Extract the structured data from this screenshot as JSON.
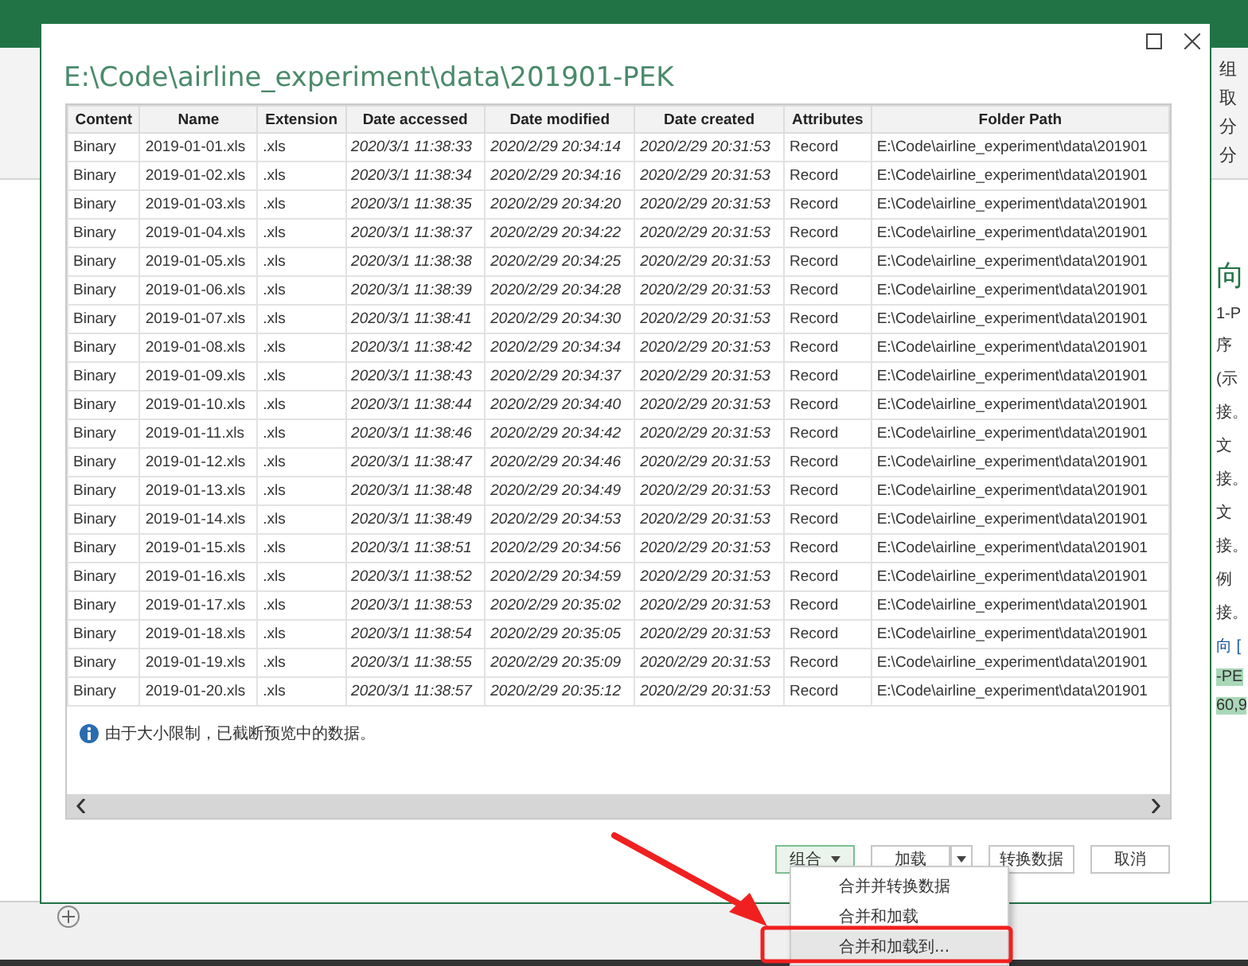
{
  "background_app": {
    "ribbon_right": [
      "组",
      "取",
      "分",
      "分"
    ],
    "pane_right": [
      {
        "text": "向",
        "kind": "heading"
      },
      {
        "text": "1-P",
        "kind": "line"
      },
      {
        "text": "序",
        "kind": "line"
      },
      {
        "text": "(示",
        "kind": "line"
      },
      {
        "text": "接。",
        "kind": "line"
      },
      {
        "text": "文",
        "kind": "line"
      },
      {
        "text": "接。",
        "kind": "line"
      },
      {
        "text": "文",
        "kind": "line"
      },
      {
        "text": "接。",
        "kind": "line"
      },
      {
        "text": "例",
        "kind": "line"
      },
      {
        "text": "接。",
        "kind": "line"
      },
      {
        "text": "向 [",
        "kind": "link"
      },
      {
        "text": "-PE",
        "kind": "selected"
      },
      {
        "text": "60,9",
        "kind": "selected"
      }
    ]
  },
  "dialog": {
    "title": "E:\\Code\\airline_experiment\\data\\201901-PEK",
    "table": {
      "columns": [
        "Content",
        "Name",
        "Extension",
        "Date accessed",
        "Date modified",
        "Date created",
        "Attributes",
        "Folder Path"
      ],
      "rows": [
        [
          "Binary",
          "2019-01-01.xls",
          ".xls",
          "2020/3/1 11:38:33",
          "2020/2/29 20:34:14",
          "2020/2/29 20:31:53",
          "Record",
          "E:\\Code\\airline_experiment\\data\\201901"
        ],
        [
          "Binary",
          "2019-01-02.xls",
          ".xls",
          "2020/3/1 11:38:34",
          "2020/2/29 20:34:16",
          "2020/2/29 20:31:53",
          "Record",
          "E:\\Code\\airline_experiment\\data\\201901"
        ],
        [
          "Binary",
          "2019-01-03.xls",
          ".xls",
          "2020/3/1 11:38:35",
          "2020/2/29 20:34:20",
          "2020/2/29 20:31:53",
          "Record",
          "E:\\Code\\airline_experiment\\data\\201901"
        ],
        [
          "Binary",
          "2019-01-04.xls",
          ".xls",
          "2020/3/1 11:38:37",
          "2020/2/29 20:34:22",
          "2020/2/29 20:31:53",
          "Record",
          "E:\\Code\\airline_experiment\\data\\201901"
        ],
        [
          "Binary",
          "2019-01-05.xls",
          ".xls",
          "2020/3/1 11:38:38",
          "2020/2/29 20:34:25",
          "2020/2/29 20:31:53",
          "Record",
          "E:\\Code\\airline_experiment\\data\\201901"
        ],
        [
          "Binary",
          "2019-01-06.xls",
          ".xls",
          "2020/3/1 11:38:39",
          "2020/2/29 20:34:28",
          "2020/2/29 20:31:53",
          "Record",
          "E:\\Code\\airline_experiment\\data\\201901"
        ],
        [
          "Binary",
          "2019-01-07.xls",
          ".xls",
          "2020/3/1 11:38:41",
          "2020/2/29 20:34:30",
          "2020/2/29 20:31:53",
          "Record",
          "E:\\Code\\airline_experiment\\data\\201901"
        ],
        [
          "Binary",
          "2019-01-08.xls",
          ".xls",
          "2020/3/1 11:38:42",
          "2020/2/29 20:34:34",
          "2020/2/29 20:31:53",
          "Record",
          "E:\\Code\\airline_experiment\\data\\201901"
        ],
        [
          "Binary",
          "2019-01-09.xls",
          ".xls",
          "2020/3/1 11:38:43",
          "2020/2/29 20:34:37",
          "2020/2/29 20:31:53",
          "Record",
          "E:\\Code\\airline_experiment\\data\\201901"
        ],
        [
          "Binary",
          "2019-01-10.xls",
          ".xls",
          "2020/3/1 11:38:44",
          "2020/2/29 20:34:40",
          "2020/2/29 20:31:53",
          "Record",
          "E:\\Code\\airline_experiment\\data\\201901"
        ],
        [
          "Binary",
          "2019-01-11.xls",
          ".xls",
          "2020/3/1 11:38:46",
          "2020/2/29 20:34:42",
          "2020/2/29 20:31:53",
          "Record",
          "E:\\Code\\airline_experiment\\data\\201901"
        ],
        [
          "Binary",
          "2019-01-12.xls",
          ".xls",
          "2020/3/1 11:38:47",
          "2020/2/29 20:34:46",
          "2020/2/29 20:31:53",
          "Record",
          "E:\\Code\\airline_experiment\\data\\201901"
        ],
        [
          "Binary",
          "2019-01-13.xls",
          ".xls",
          "2020/3/1 11:38:48",
          "2020/2/29 20:34:49",
          "2020/2/29 20:31:53",
          "Record",
          "E:\\Code\\airline_experiment\\data\\201901"
        ],
        [
          "Binary",
          "2019-01-14.xls",
          ".xls",
          "2020/3/1 11:38:49",
          "2020/2/29 20:34:53",
          "2020/2/29 20:31:53",
          "Record",
          "E:\\Code\\airline_experiment\\data\\201901"
        ],
        [
          "Binary",
          "2019-01-15.xls",
          ".xls",
          "2020/3/1 11:38:51",
          "2020/2/29 20:34:56",
          "2020/2/29 20:31:53",
          "Record",
          "E:\\Code\\airline_experiment\\data\\201901"
        ],
        [
          "Binary",
          "2019-01-16.xls",
          ".xls",
          "2020/3/1 11:38:52",
          "2020/2/29 20:34:59",
          "2020/2/29 20:31:53",
          "Record",
          "E:\\Code\\airline_experiment\\data\\201901"
        ],
        [
          "Binary",
          "2019-01-17.xls",
          ".xls",
          "2020/3/1 11:38:53",
          "2020/2/29 20:35:02",
          "2020/2/29 20:31:53",
          "Record",
          "E:\\Code\\airline_experiment\\data\\201901"
        ],
        [
          "Binary",
          "2019-01-18.xls",
          ".xls",
          "2020/3/1 11:38:54",
          "2020/2/29 20:35:05",
          "2020/2/29 20:31:53",
          "Record",
          "E:\\Code\\airline_experiment\\data\\201901"
        ],
        [
          "Binary",
          "2019-01-19.xls",
          ".xls",
          "2020/3/1 11:38:55",
          "2020/2/29 20:35:09",
          "2020/2/29 20:31:53",
          "Record",
          "E:\\Code\\airline_experiment\\data\\201901"
        ],
        [
          "Binary",
          "2019-01-20.xls",
          ".xls",
          "2020/3/1 11:38:57",
          "2020/2/29 20:35:12",
          "2020/2/29 20:31:53",
          "Record",
          "E:\\Code\\airline_experiment\\data\\201901"
        ]
      ]
    },
    "notice": "由于大小限制，已截断预览中的数据。",
    "buttons": [
      {
        "label": "组合",
        "kind": "dropdown",
        "open": true
      },
      {
        "label": "加载",
        "kind": "split",
        "open": false
      },
      {
        "label": "转换数据",
        "kind": "plain",
        "open": false
      },
      {
        "label": "取消",
        "kind": "plain",
        "open": false
      }
    ],
    "menu": [
      {
        "label": "合并并转换数据",
        "highlighted": false
      },
      {
        "label": "合并和加载",
        "highlighted": false
      },
      {
        "label": "合并和加载到...",
        "highlighted": true
      }
    ]
  }
}
